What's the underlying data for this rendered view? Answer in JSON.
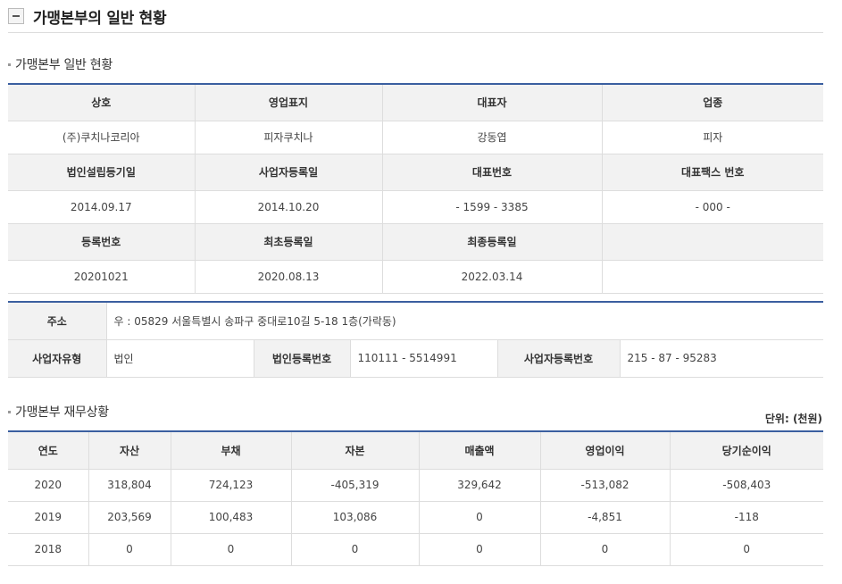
{
  "page_title": "가맹본부의 일반 현황",
  "general": {
    "section_title": "가맹본부 일반 현황",
    "headers1": [
      "상호",
      "영업표지",
      "대표자",
      "업종"
    ],
    "values1": [
      "(주)쿠치나코리아",
      "피자쿠치나",
      "강동엽",
      "피자"
    ],
    "headers2": [
      "법인설립등기일",
      "사업자등록일",
      "대표번호",
      "대표팩스 번호"
    ],
    "values2": [
      "2014.09.17",
      "2014.10.20",
      "- 1599 - 3385",
      "- 000 -"
    ],
    "headers3": [
      "등록번호",
      "최초등록일",
      "최종등록일",
      ""
    ],
    "values3": [
      "20201021",
      "2020.08.13",
      "2022.03.14",
      ""
    ]
  },
  "address": {
    "label": "주소",
    "value": "우 : 05829 서울특별시 송파구 중대로10길 5-18 1층(가락동)",
    "biz_type_label": "사업자유형",
    "biz_type_value": "법인",
    "corp_no_label": "법인등록번호",
    "corp_no_value": "110111 - 5514991",
    "biz_no_label": "사업자등록번호",
    "biz_no_value": "215 - 87 - 95283"
  },
  "finance": {
    "section_title": "가맹본부 재무상황",
    "unit": "단위: (천원)",
    "headers": [
      "연도",
      "자산",
      "부채",
      "자본",
      "매출액",
      "영업이익",
      "당기순이익"
    ],
    "rows": [
      [
        "2020",
        "318,804",
        "724,123",
        "-405,319",
        "329,642",
        "-513,082",
        "-508,403"
      ],
      [
        "2019",
        "203,569",
        "100,483",
        "103,086",
        "0",
        "-4,851",
        "-118"
      ],
      [
        "2018",
        "0",
        "0",
        "0",
        "0",
        "0",
        "0"
      ]
    ]
  }
}
